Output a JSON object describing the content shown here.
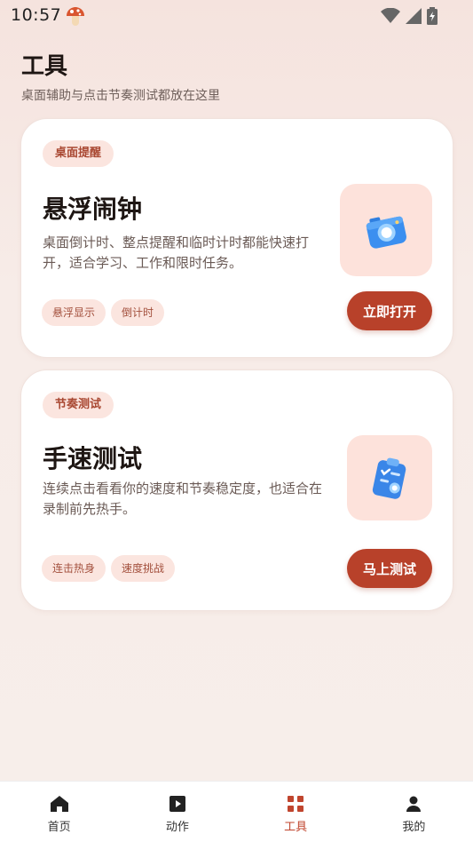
{
  "status": {
    "time": "10:57"
  },
  "header": {
    "title": "工具",
    "subtitle": "桌面辅助与点击节奏测试都放在这里"
  },
  "cards": [
    {
      "chip": "桌面提醒",
      "title": "悬浮闹钟",
      "description": "桌面倒计时、整点提醒和临时计时都能快速打开，适合学习、工作和限时任务。",
      "tags": [
        "悬浮显示",
        "倒计时"
      ],
      "button": "立即打开",
      "icon": "camera-icon"
    },
    {
      "chip": "节奏测试",
      "title": "手速测试",
      "description": "连续点击看看你的速度和节奏稳定度，也适合在录制前先热手。",
      "tags": [
        "连击热身",
        "速度挑战"
      ],
      "button": "马上测试",
      "icon": "clipboard-icon"
    }
  ],
  "nav": [
    {
      "label": "首页",
      "icon": "home-icon"
    },
    {
      "label": "动作",
      "icon": "play-icon"
    },
    {
      "label": "工具",
      "icon": "grid-icon",
      "active": true
    },
    {
      "label": "我的",
      "icon": "person-icon"
    }
  ],
  "colors": {
    "accent": "#b8412a",
    "chip_bg": "#fbe5df",
    "tile_bg": "#fde2db"
  }
}
